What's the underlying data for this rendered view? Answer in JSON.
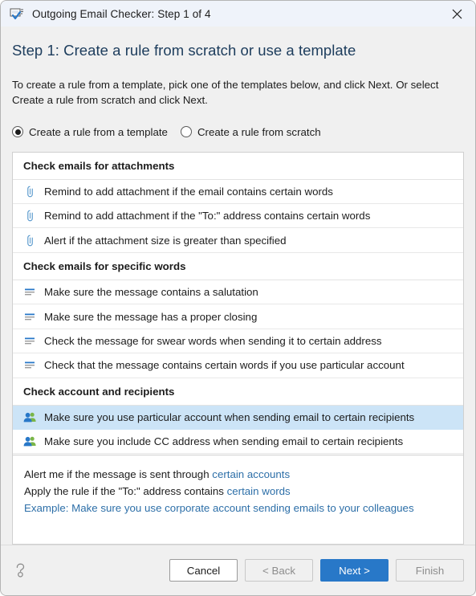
{
  "window": {
    "title": "Outgoing Email Checker: Step 1 of 4",
    "app_icon": "email-check-icon",
    "close_icon": "close-icon",
    "accent_color": "#2878c8",
    "selection_color": "#cce4f7",
    "titlebar_color": "#eff3fa"
  },
  "page": {
    "step_title": "Step 1: Create a rule from scratch or use a template",
    "intro": "To create a rule from a template, pick one of the templates below, and click Next. Or select Create a rule from scratch and click Next."
  },
  "mode_options": [
    {
      "label": "Create a rule from a template",
      "checked": true
    },
    {
      "label": "Create a rule from scratch",
      "checked": false
    }
  ],
  "template_groups": [
    {
      "header": "Check emails for attachments",
      "icon": "paperclip-icon",
      "items": [
        {
          "label": "Remind to add attachment if the email contains certain words",
          "selected": false
        },
        {
          "label": "Remind to add attachment if the \"To:\" address contains certain words",
          "selected": false
        },
        {
          "label": "Alert if the attachment size is greater than specified",
          "selected": false
        }
      ]
    },
    {
      "header": "Check emails for specific words",
      "icon": "text-lines-icon",
      "items": [
        {
          "label": "Make sure the message contains a salutation",
          "selected": false
        },
        {
          "label": "Make sure the message has a proper closing",
          "selected": false
        },
        {
          "label": "Check the message for swear words when sending it to certain address",
          "selected": false
        },
        {
          "label": "Check that the message contains certain words if you use particular account",
          "selected": false
        }
      ]
    },
    {
      "header": "Check account and recipients",
      "icon": "people-icon",
      "items": [
        {
          "label": "Make sure you use particular account when sending email to certain recipients",
          "selected": true
        },
        {
          "label": "Make sure you include CC address when sending email to certain recipients",
          "selected": false
        }
      ]
    }
  ],
  "description": {
    "line1_before": "Alert me if the message is sent through ",
    "line1_link": "certain accounts",
    "line2_before": "Apply the rule if the \"To:\" address contains ",
    "line2_link": "certain words",
    "line3": "Example: Make sure you use corporate account sending emails to your colleagues"
  },
  "footer": {
    "help_icon": "help-question-icon",
    "buttons": [
      {
        "label": "Cancel",
        "style": "default"
      },
      {
        "label": "< Back",
        "style": "disabled"
      },
      {
        "label": "Next >",
        "style": "primary"
      },
      {
        "label": "Finish",
        "style": "disabled"
      }
    ]
  }
}
